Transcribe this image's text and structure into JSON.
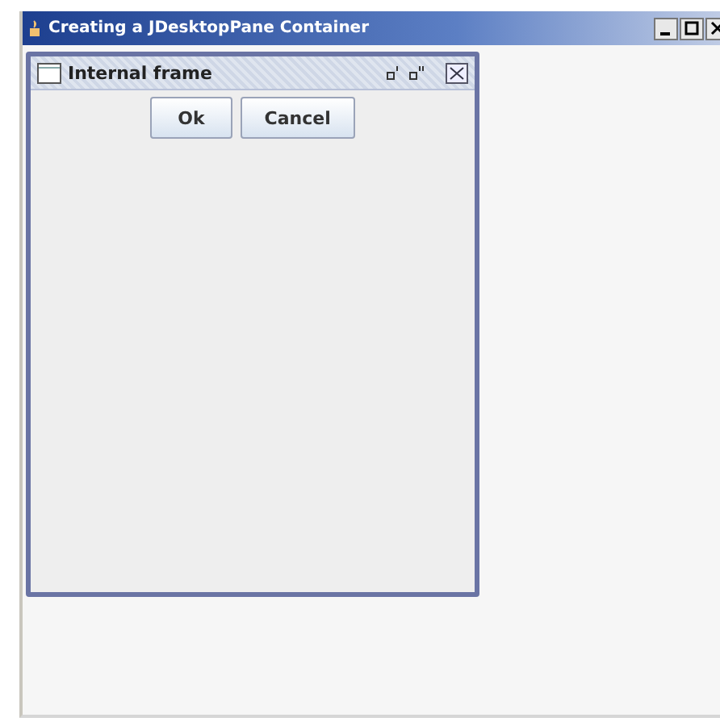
{
  "window": {
    "title": "Creating a JDesktopPane Container"
  },
  "internal_frame": {
    "title": "Internal frame",
    "buttons": [
      {
        "label": "Ok"
      },
      {
        "label": "Cancel"
      }
    ]
  }
}
